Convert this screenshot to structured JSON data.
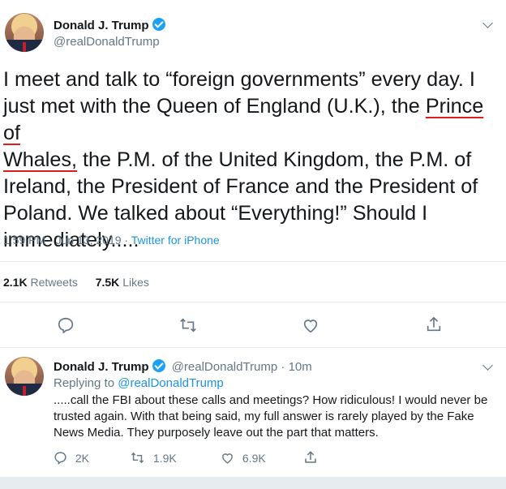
{
  "main_tweet": {
    "author_name": "Donald J. Trump",
    "author_handle": "@realDonaldTrump",
    "text_part1": "I meet and talk to “foreign governments” every day. I just met with the Queen of England (U.K.), the ",
    "text_underlined1": "Prince of",
    "text_underlined2": "Whales,",
    "text_part2": " the P.M. of the United Kingdom, the P.M. of Ireland, the President of France and the President of Poland. We talked about “Everything!” Should I immediately.....",
    "timestamp": "1:59 PM · Jun 13, 2019 · ",
    "source": "Twitter for iPhone",
    "retweets_count": "2.1K",
    "retweets_label": "Retweets",
    "likes_count": "7.5K",
    "likes_label": "Likes"
  },
  "reply_tweet": {
    "author_name": "Donald J. Trump",
    "author_handle": "@realDonaldTrump · 10m",
    "replying_to_label": "Replying to ",
    "replying_to_handle": "@realDonaldTrump",
    "text": ".....call the FBI about these calls and meetings? How ridiculous! I would never be trusted again. With that being said, my full answer is rarely played by the Fake News Media. They purposely leave out the part that matters.",
    "reply_count": "2K",
    "retweet_count": "1.9K",
    "like_count": "6.9K"
  },
  "colors": {
    "accent": "#1da1f2",
    "link": "#1b95e0",
    "muted": "#657786",
    "underline_annotation": "#e01c1c"
  },
  "icons": [
    "reply-icon",
    "retweet-icon",
    "like-icon",
    "share-icon",
    "verified-icon",
    "chevron-down-icon"
  ]
}
